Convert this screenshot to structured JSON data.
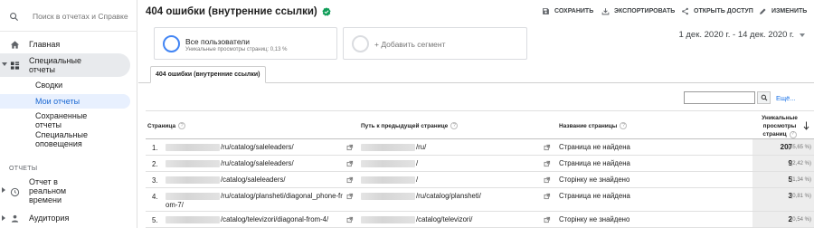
{
  "sidebar": {
    "search_placeholder": "Поиск в отчетах и Справке",
    "home_label": "Главная",
    "custom_reports_label": "Специальные отчеты",
    "sub_items": [
      {
        "label": "Сводки"
      },
      {
        "label": "Мои отчеты"
      },
      {
        "label": "Сохраненные отчеты"
      },
      {
        "label": "Специальные оповещения"
      }
    ],
    "section_reports": "ОТЧЕТЫ",
    "realtime_label": "Отчет в реальном времени",
    "audience_label": "Аудитория"
  },
  "header": {
    "title": "404 ошибки (внутренние ссылки)",
    "save": "СОХРАНИТЬ",
    "export": "ЭКСПОРТИРОВАТЬ",
    "share": "ОТКРЫТЬ ДОСТУП",
    "edit": "ИЗМЕНИТЬ"
  },
  "segments": {
    "seg1_title": "Все пользователи",
    "seg1_sub": "Уникальные просмотры страниц: 0,13 %",
    "seg2_title": "+ Добавить сегмент"
  },
  "date_range": "1 дек. 2020 г. - 14 дек. 2020 г.",
  "tab_label": "404 ошибки (внутренние ссылки)",
  "table_search": {
    "more_label": "Ещё..."
  },
  "table": {
    "col_page": "Страница",
    "col_prev": "Путь к предыдущей странице",
    "col_title": "Название страницы",
    "col_metric_line1": "Уникальные",
    "col_metric_line2": "просмотры",
    "col_metric_line3": "страниц",
    "rows": [
      {
        "n": "1.",
        "page": "/ru/catalog/saleleaders/",
        "prev": "/ru/",
        "title": "Страница не найдена",
        "value": "207",
        "pct": "(55,65 %)"
      },
      {
        "n": "2.",
        "page": "/ru/catalog/saleleaders/",
        "prev": "/",
        "title": "Страница не найдена",
        "value": "9",
        "pct": "(2,42 %)"
      },
      {
        "n": "3.",
        "page": "/catalog/saleleaders/",
        "prev": "/",
        "title": "Сторінку не знайдено",
        "value": "5",
        "pct": "(1,34 %)"
      },
      {
        "n": "4.",
        "page": "/ru/catalog/plansheti/diagonal_phone-fr",
        "page2": "om-7/",
        "prev": "/ru/catalog/plansheti/",
        "title": "Страница не найдена",
        "value": "3",
        "pct": "(0,81 %)"
      },
      {
        "n": "5.",
        "page": "/catalog/televizori/diagonal-from-4/",
        "prev": "/catalog/televizori/",
        "title": "Сторінку не знайдено",
        "value": "2",
        "pct": "(0,54 %)"
      }
    ]
  }
}
